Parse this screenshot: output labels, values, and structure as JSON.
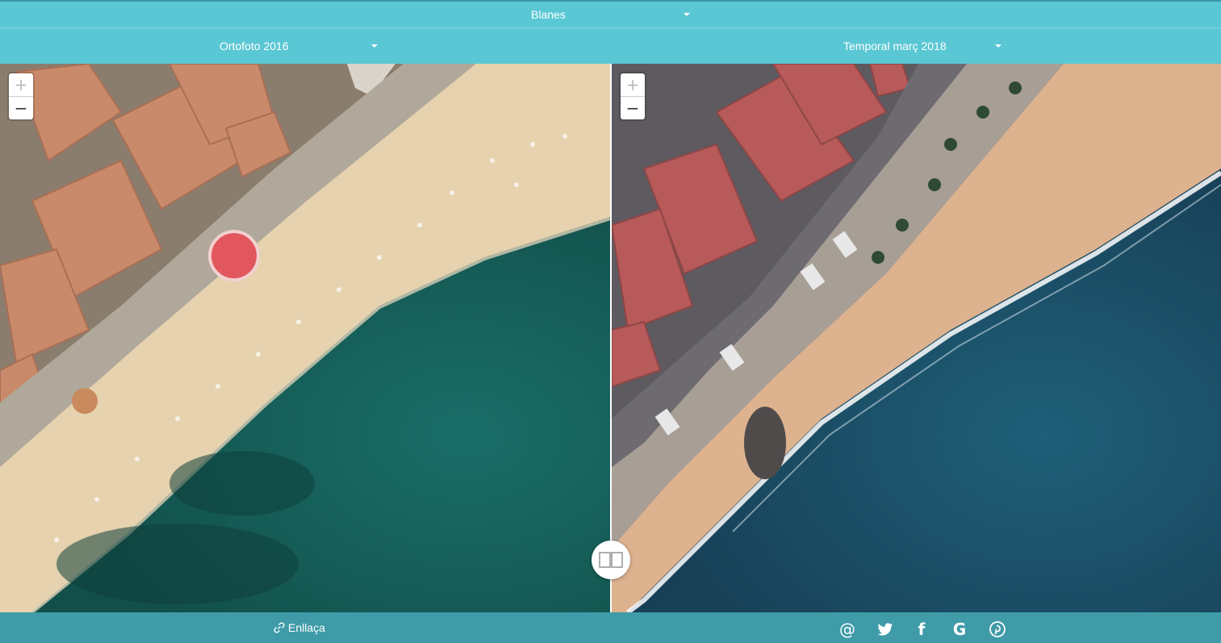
{
  "header": {
    "location": "Blanes"
  },
  "layers": {
    "left": "Ortofoto 2016",
    "right": "Temporal març 2018"
  },
  "zoom": {
    "in": "+",
    "out": "−"
  },
  "footer": {
    "link_label": "Enllaça",
    "share_icons": [
      "at-icon",
      "twitter-icon",
      "facebook-icon",
      "google-icon",
      "pinterest-icon"
    ],
    "share_glyphs": [
      "@",
      "",
      "f",
      "G",
      "P"
    ]
  },
  "colors": {
    "bar": "#5ac7d4",
    "footer": "#3f9ba8",
    "sea_left": "#1b6b63",
    "sea_right": "#1d5a72",
    "sand": "#e8d3b0"
  }
}
